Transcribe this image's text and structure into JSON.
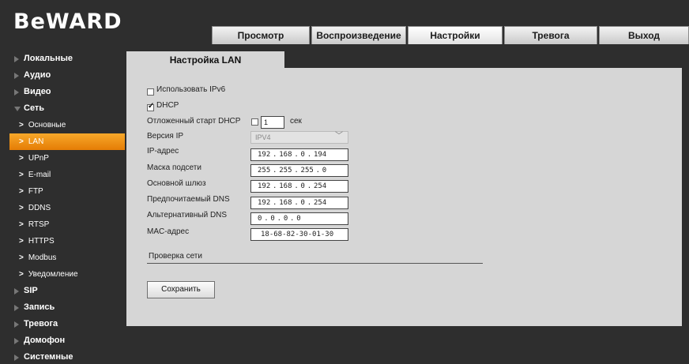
{
  "header": {
    "logo_text": "BeWARD",
    "tabs": [
      {
        "label": "Просмотр",
        "active": false
      },
      {
        "label": "Воспроизведение",
        "active": false
      },
      {
        "label": "Настройки",
        "active": true
      },
      {
        "label": "Тревога",
        "active": false
      },
      {
        "label": "Выход",
        "active": false
      }
    ]
  },
  "sidebar": {
    "items": [
      {
        "label": "Локальные"
      },
      {
        "label": "Аудио"
      },
      {
        "label": "Видео"
      },
      {
        "label": "Сеть",
        "expanded": true,
        "children": [
          {
            "label": "Основные"
          },
          {
            "label": "LAN",
            "active": true
          },
          {
            "label": "UPnP"
          },
          {
            "label": "E-mail"
          },
          {
            "label": "FTP"
          },
          {
            "label": "DDNS"
          },
          {
            "label": "RTSP"
          },
          {
            "label": "HTTPS"
          },
          {
            "label": "Modbus"
          },
          {
            "label": "Уведомление"
          }
        ]
      },
      {
        "label": "SIP"
      },
      {
        "label": "Запись"
      },
      {
        "label": "Тревога"
      },
      {
        "label": "Домофон"
      },
      {
        "label": "Системные"
      }
    ]
  },
  "content": {
    "tab_title": "Настройка LAN",
    "use_ipv6": {
      "label": "Использовать IPv6",
      "checked": false
    },
    "dhcp": {
      "label": "DHCP",
      "checked": true
    },
    "dhcp_delay": {
      "label": "Отложенный старт DHCP",
      "checked": false,
      "value": "1",
      "unit": "сек"
    },
    "ip_version": {
      "label": "Версия IP",
      "value": "IPV4"
    },
    "ip_address": {
      "label": "IP-адрес",
      "octets": [
        "192",
        "168",
        "0",
        "194"
      ]
    },
    "subnet_mask": {
      "label": "Маска подсети",
      "octets": [
        "255",
        "255",
        "255",
        "0"
      ]
    },
    "gateway": {
      "label": "Основной шлюз",
      "octets": [
        "192",
        "168",
        "0",
        "254"
      ]
    },
    "preferred_dns": {
      "label": "Предпочитаемый DNS",
      "octets": [
        "192",
        "168",
        "0",
        "254"
      ]
    },
    "alternate_dns": {
      "label": "Альтернативный DNS",
      "octets": [
        "0",
        "0",
        "0",
        "0"
      ]
    },
    "mac_address": {
      "label": "MAC-адрес",
      "value": "18-68-82-30-01-30"
    },
    "network_check_label": "Проверка сети",
    "save_label": "Сохранить"
  },
  "colors": {
    "background": "#2e2e2e",
    "panel": "#d6d6d6",
    "accent_orange": "#f39a1f"
  }
}
